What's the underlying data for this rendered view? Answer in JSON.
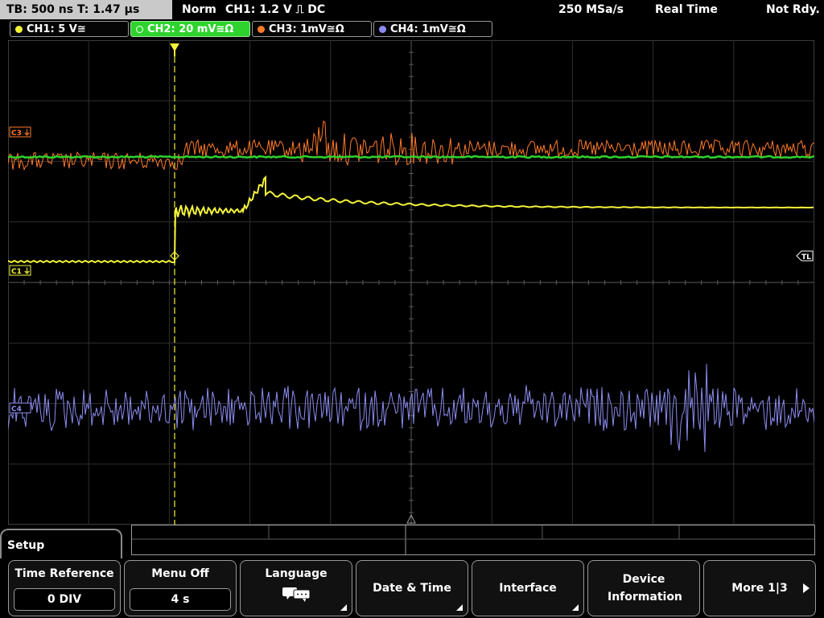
{
  "topbar": {
    "timebase": "TB: 500 ns   T: 1.47 µs",
    "trigger_mode": "Norm",
    "trigger_info": "CH1: 1.2 V ⎍ DC",
    "sample_rate": "250 MSa/s",
    "acq_mode": "Real Time",
    "status": "Not Rdy."
  },
  "channels": [
    {
      "label": "CH1: 5 V≅",
      "color": "#f4f43a",
      "active": false
    },
    {
      "label": "CH2: 20 mV≅Ω",
      "color": "#2ed32e",
      "active": true
    },
    {
      "label": "CH3: 1mV≅Ω",
      "color": "#ff7a2a",
      "active": false
    },
    {
      "label": "CH4: 1mV≅Ω",
      "color": "#8c8cf0",
      "active": false
    }
  ],
  "markers": {
    "c3": "C3",
    "c1": "C1",
    "c4": "C4",
    "trigger_level": "TL"
  },
  "menu": {
    "title": "Setup",
    "keys": [
      {
        "label": "Time Reference",
        "value": "0 DIV"
      },
      {
        "label": "Menu Off",
        "value": "4 s"
      },
      {
        "label": "Language"
      },
      {
        "label": "Date & Time"
      },
      {
        "label": "Interface"
      },
      {
        "label": "Device Information"
      },
      {
        "label": "More 1|3"
      }
    ]
  }
}
